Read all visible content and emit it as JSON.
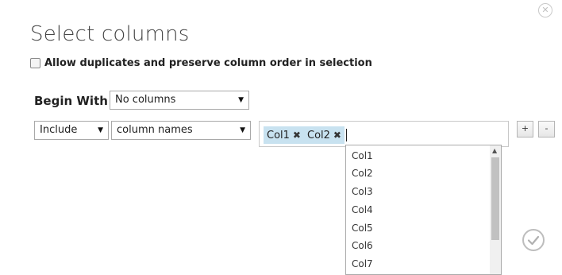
{
  "dialog": {
    "title": "Select columns"
  },
  "allow_duplicates": {
    "label": "Allow duplicates and preserve column order in selection",
    "checked": false
  },
  "begin_with": {
    "label": "Begin With",
    "value": "No columns"
  },
  "rule": {
    "include_value": "Include",
    "by_value": "column names",
    "tags": [
      "Col1",
      "Col2"
    ]
  },
  "buttons": {
    "add": "+",
    "remove": "-"
  },
  "dropdown": {
    "options": [
      "Col1",
      "Col2",
      "Col3",
      "Col4",
      "Col5",
      "Col6",
      "Col7"
    ]
  },
  "icons": {
    "close": "close-icon",
    "confirm": "checkmark-icon",
    "tag_remove": "x-icon",
    "select_arrow": "triangle-down-icon"
  },
  "colors": {
    "tag_bg": "#c8e2f0",
    "border": "#a9a9a9"
  }
}
